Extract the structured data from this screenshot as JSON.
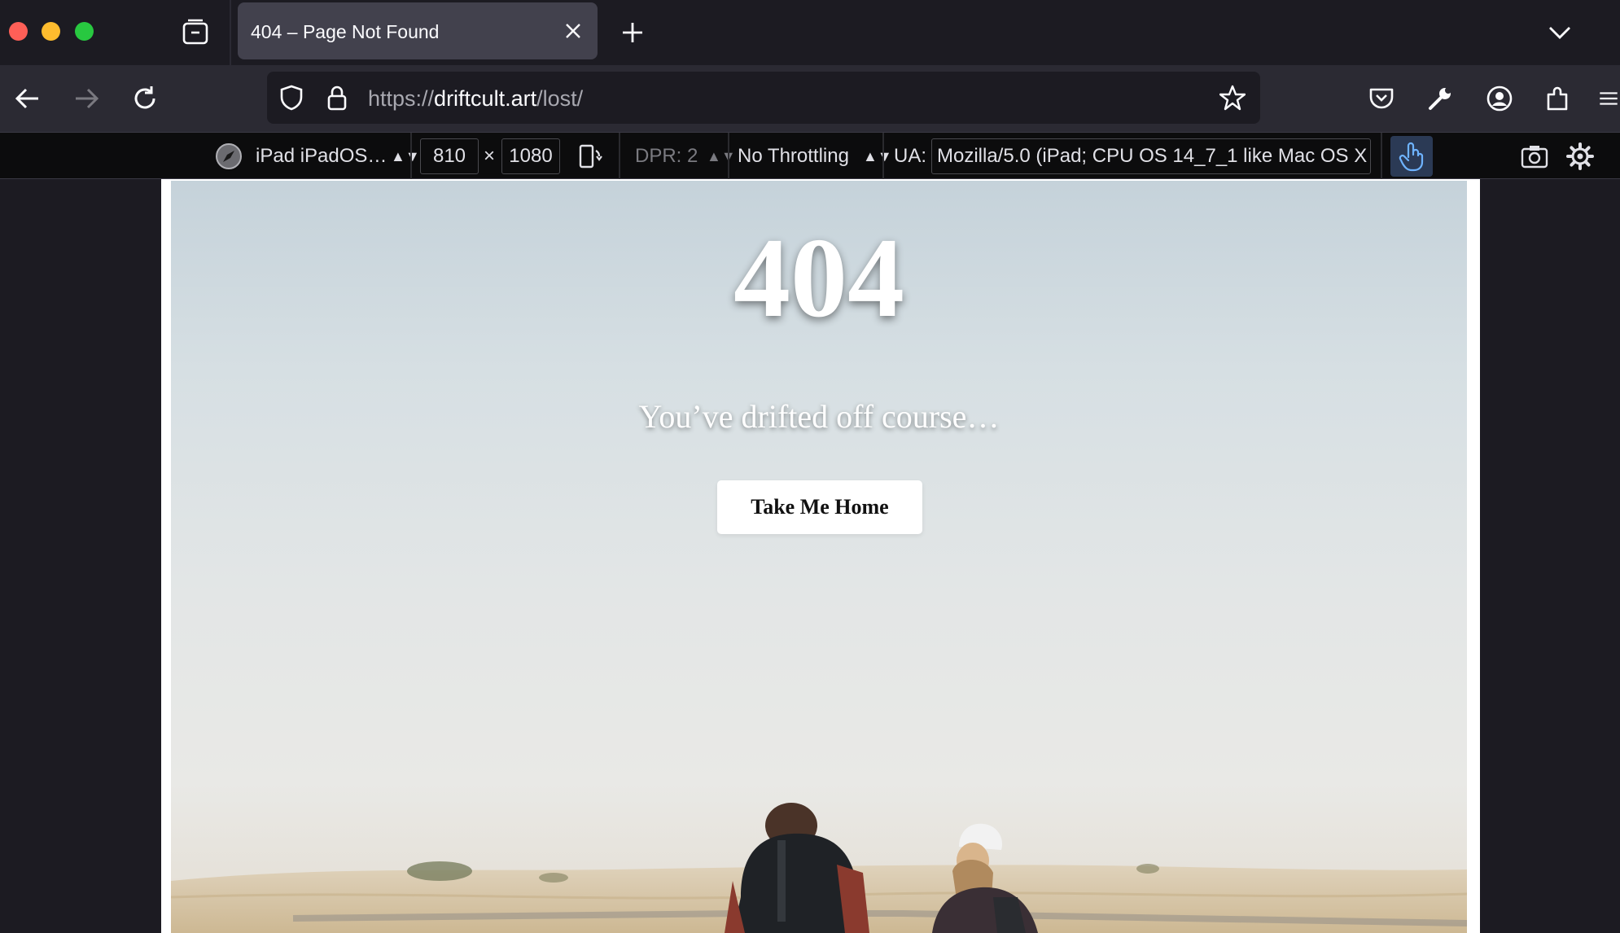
{
  "browser": {
    "tab": {
      "title": "404 – Page Not Found"
    },
    "url": {
      "scheme": "https://",
      "host": "driftcult.art",
      "path": "/lost/"
    }
  },
  "rdm": {
    "device": "iPad iPadOS…",
    "width": "810",
    "times": "×",
    "height": "1080",
    "dpr": "DPR: 2",
    "throttling": "No Throttling",
    "ua_label": "UA:",
    "ua_value": "Mozilla/5.0 (iPad; CPU OS 14_7_1 like Mac OS X"
  },
  "page": {
    "code": "404",
    "message": "You’ve drifted off course…",
    "button_label": "Take Me Home"
  },
  "icons": {
    "tabs_menu": "tab-tray-icon",
    "tab_close": "close-icon",
    "new_tab": "plus-icon",
    "tab_list": "chevron-down-icon",
    "back": "back-arrow-icon",
    "forward": "forward-arrow-icon",
    "reload": "reload-icon",
    "tracking": "shield-icon",
    "lock": "lock-icon",
    "bookmark": "star-icon",
    "pocket": "pocket-icon",
    "devtools": "wrench-icon",
    "account": "account-icon",
    "extensions": "puzzle-icon",
    "menu": "hamburger-icon",
    "device_badge": "compass-icon",
    "rotate": "rotate-device-icon",
    "touch": "touch-hand-icon",
    "screenshot": "camera-icon",
    "settings": "gear-icon"
  },
  "colors": {
    "chrome_dark": "#1c1b22",
    "navbar": "#2b2a33",
    "tab_active": "#42414d",
    "rdm_bg": "#0c0c0d",
    "touch_active": "#2b3a55",
    "sky_top": "#c5d2da",
    "sand": "#d8c6a8"
  }
}
